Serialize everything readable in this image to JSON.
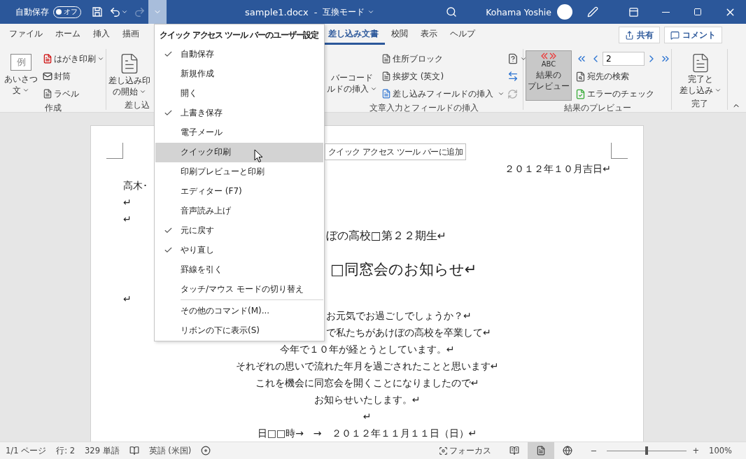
{
  "title_bar": {
    "autosave": {
      "label": "自動保存",
      "on": false,
      "state_text": "オフ"
    },
    "undo_disabled": false,
    "redo_disabled": true,
    "qat_menu_expanded": true,
    "document_title": "sample1.docx",
    "separator": "-",
    "mode": "互換モード",
    "user_name": "Kohama Yoshie"
  },
  "ribbon_tabs": [
    {
      "label": "ファイル",
      "selected": false
    },
    {
      "label": "ホーム",
      "selected": false
    },
    {
      "label": "挿入",
      "selected": false
    },
    {
      "label": "描画",
      "selected": false
    },
    {
      "label": "差し込み文書",
      "selected": true
    },
    {
      "label": "校閲",
      "selected": false
    },
    {
      "label": "表示",
      "selected": false
    },
    {
      "label": "ヘルプ",
      "selected": false
    }
  ],
  "share_button": "共有",
  "comment_button": "コメント",
  "ribbon": {
    "create_group": {
      "label": "作成",
      "greeting_button": {
        "icon_text": "例",
        "lines": [
          "あいさつ",
          "文"
        ]
      },
      "small_buttons": [
        {
          "label": "はがき印刷",
          "has_caret": true
        },
        {
          "label": "封筒",
          "has_caret": false
        },
        {
          "label": "ラベル",
          "has_caret": false
        }
      ]
    },
    "start_group": {
      "label": "差し込",
      "button_lines": [
        "差し込み印",
        "の開始"
      ]
    },
    "fields_group": {
      "label": "文章入力とフィールドの挿入",
      "barcode_lines": [
        "バーコード",
        "ルドの挿入"
      ],
      "small_buttons": [
        {
          "label": "住所ブロック",
          "has_caret": false
        },
        {
          "label": "挨拶文 (英文)",
          "has_caret": false
        },
        {
          "label": "差し込みフィールドの挿入",
          "has_caret": true
        }
      ],
      "update_labels_disabled": true
    },
    "preview_group": {
      "label": "結果のプレビュー",
      "preview_button": {
        "icon_text": "ABC",
        "lines": [
          "結果の",
          "プレビュー"
        ],
        "selected": true
      },
      "record_number": "2",
      "small_buttons": [
        {
          "label": "宛先の検索"
        },
        {
          "label": "エラーのチェック"
        }
      ]
    },
    "finish_group": {
      "label": "完了",
      "button_lines": [
        "完了と",
        "差し込み"
      ]
    }
  },
  "document": {
    "lines": [
      {
        "kind": "right",
        "text": "２０１２年１０月吉日↵"
      },
      {
        "kind": "left",
        "text": "高木･"
      },
      {
        "kind": "left",
        "text": "↵"
      },
      {
        "kind": "left",
        "text": "↵"
      },
      {
        "kind": "cut",
        "text": "ぼの高校□第２２期生↵"
      },
      {
        "kind": "cut_heading",
        "text": "□同窓会のお知らせ↵"
      },
      {
        "kind": "left",
        "text": "↵"
      },
      {
        "kind": "cut",
        "text": "お元気でお過ごしでしょうか？↵"
      },
      {
        "kind": "cut",
        "text": "で私たちがあけぼの高校を卒業して↵"
      },
      {
        "kind": "center",
        "text": "今年で１０年が経とうとしています。↵"
      },
      {
        "kind": "center",
        "text": "それぞれの思いで流れた年月を過ごされたことと思います↵"
      },
      {
        "kind": "center",
        "text": "これを機会に同窓会を開くことになりましたので↵"
      },
      {
        "kind": "center",
        "text": "お知らせいたします。↵"
      },
      {
        "kind": "center",
        "text": "↵"
      },
      {
        "kind": "center",
        "text": "日□□時→　→　２０１２年１１月１１日（日）↵"
      }
    ]
  },
  "qat_menu": {
    "title": "クイック アクセス ツール バーのユーザー設定",
    "items": [
      {
        "label": "自動保存",
        "checked": true,
        "selected": false
      },
      {
        "label": "新規作成",
        "checked": false,
        "selected": false
      },
      {
        "label": "開く",
        "checked": false,
        "selected": false
      },
      {
        "label": "上書き保存",
        "checked": true,
        "selected": false
      },
      {
        "label": "電子メール",
        "checked": false,
        "selected": false
      },
      {
        "label": "クイック印刷",
        "checked": false,
        "selected": true
      },
      {
        "label": "印刷プレビューと印刷",
        "checked": false,
        "selected": false
      },
      {
        "label": "エディター (F7)",
        "checked": false,
        "selected": false
      },
      {
        "label": "音声読み上げ",
        "checked": false,
        "selected": false
      },
      {
        "label": "元に戻す",
        "checked": true,
        "selected": false
      },
      {
        "label": "やり直し",
        "checked": true,
        "selected": false
      },
      {
        "label": "罫線を引く",
        "checked": false,
        "selected": false
      },
      {
        "label": "タッチ/マウス モードの切り替え",
        "checked": false,
        "selected": false
      }
    ],
    "commands": [
      {
        "label": "その他のコマンド(M)...",
        "selected": false
      },
      {
        "label": "リボンの下に表示(S)",
        "selected": false
      }
    ],
    "tooltip": "クイック アクセス ツール バーに追加"
  },
  "status_bar": {
    "page": "1/1 ページ",
    "line": "行: 2",
    "words": "329 単語",
    "language": "英語 (米国)",
    "focus": "フォーカス",
    "views": [
      {
        "kind": "read",
        "selected": false
      },
      {
        "kind": "print",
        "selected": true
      },
      {
        "kind": "web",
        "selected": false
      }
    ],
    "zoom_out": "−",
    "zoom_in": "+",
    "zoom": {
      "level": 0.5
    },
    "zoom_text": "100%"
  }
}
